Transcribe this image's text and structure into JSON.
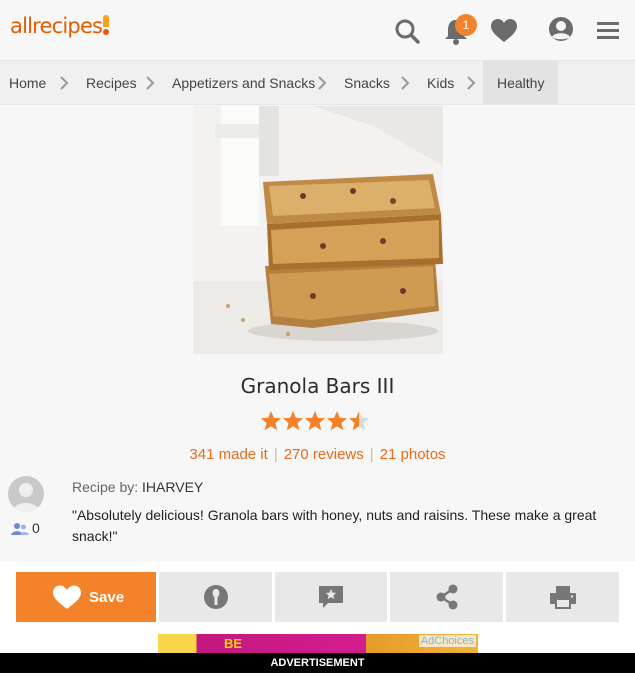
{
  "header": {
    "logo_text": "allrecipes",
    "notification_count": "1",
    "icons": [
      "search-icon",
      "bell-icon",
      "heart-icon",
      "profile-icon",
      "menu-icon"
    ]
  },
  "breadcrumb": [
    "Home",
    "Recipes",
    "Appetizers and Snacks",
    "Snacks",
    "Kids",
    "Healthy"
  ],
  "recipe": {
    "title": "Granola Bars III",
    "rating": 4.5,
    "rating_max": 5,
    "made_it": "341 made it",
    "reviews": "270 reviews",
    "photos": "21 photos"
  },
  "author": {
    "label": "Recipe by:",
    "name": "IHARVEY",
    "followers": "0",
    "quote": "\"Absolutely delicious! Granola bars with honey, nuts and raisins. These make a great snack!\""
  },
  "actions": {
    "save_label": "Save",
    "icons": [
      "made-it-icon",
      "review-icon",
      "share-icon",
      "print-icon"
    ]
  },
  "ad": {
    "adchoices": "AdChoices",
    "brand_fragment": "BE",
    "label": "ADVERTISEMENT"
  },
  "colors": {
    "accent": "#f4822a",
    "link": "#e66b1b",
    "star": "#f4822a"
  }
}
